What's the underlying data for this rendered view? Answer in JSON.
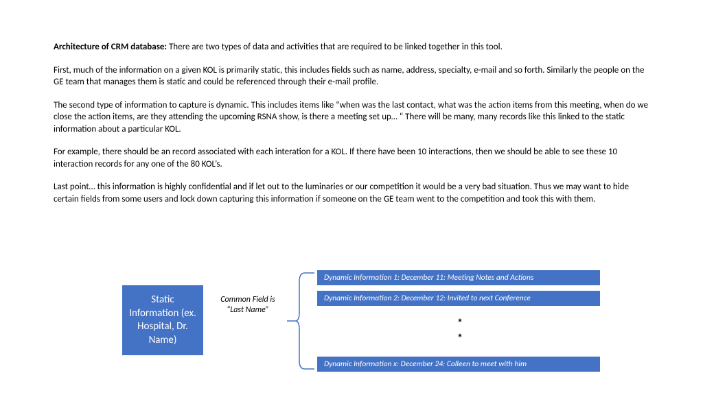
{
  "heading": "Architecture of CRM database:",
  "head_rest": "   There are two types of data and activities that are required to be linked together in this tool.",
  "para1": "First, much of the information on a given KOL is primarily static, this includes fields such as name, address, specialty, e-mail and so forth.   Similarly the people on the GE team that manages them is static and could be referenced through their e-mail profile.",
  "para2": "The second type of information to capture is dynamic.   This includes items like “when was the last contact, what was the action items from this meeting, when do we close the action items, are they attending the upcoming RSNA show, is there a meeting set up… “   There will be many, many records like this linked to the static information about a particular KOL.",
  "para3": "For example, there should be an record associated with each interation for a KOL.  If there have been 10 interactions, then we should be able to see these 10 interaction records for any one of the 80 KOL’s.",
  "para4": "Last point… this information is highly confidential and if let out to the luminaries or our competition it would be a very bad situation.   Thus we may want to hide certain fields from some users and lock down capturing this information if someone on the GE team went to the competition and took this with them.",
  "static_box": "Static Information (ex. Hospital, Dr. Name)",
  "common_field": "Common Field is “Last Name”",
  "dyn1": "Dynamic Information 1:  December 11: Meeting Notes and Actions",
  "dyn2": "Dynamic Information 2:  December 12: Invited to next Conference",
  "dynx": "Dynamic Information x:  December 24:  Colleen to meet with him",
  "star": "*"
}
